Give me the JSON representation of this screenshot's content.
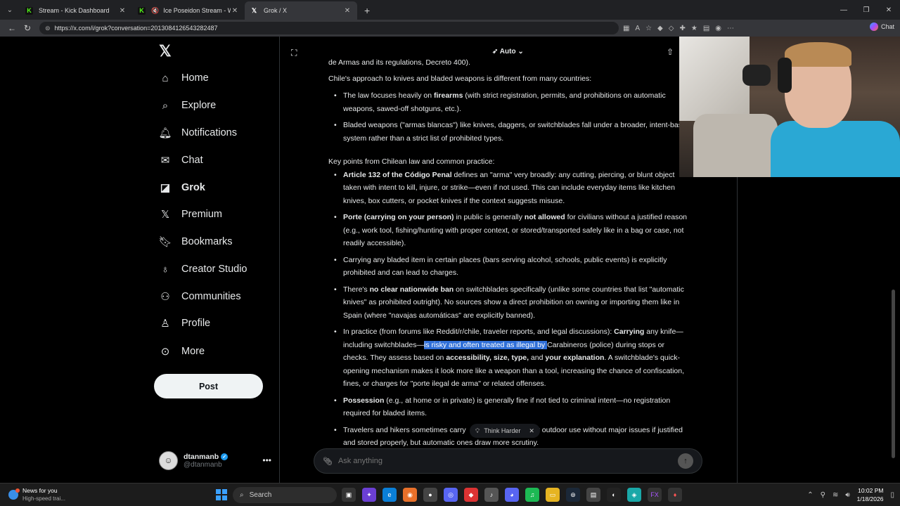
{
  "browser": {
    "tabs": [
      {
        "label": "Stream - Kick Dashboard",
        "favicon": "kick-icon"
      },
      {
        "label": "Ice Poseidon Stream - Watch",
        "favicon": "kick-icon"
      },
      {
        "label": "Grok / X",
        "favicon": "x-icon"
      }
    ],
    "url": "https://x.com/i/grok?conversation=2013084126543282487",
    "chat_label": "Chat"
  },
  "sidebar": {
    "items": [
      {
        "label": "Home",
        "icon": "home-icon"
      },
      {
        "label": "Explore",
        "icon": "search-icon"
      },
      {
        "label": "Notifications",
        "icon": "bell-icon"
      },
      {
        "label": "Chat",
        "icon": "mail-icon"
      },
      {
        "label": "Grok",
        "icon": "grok-icon"
      },
      {
        "label": "Premium",
        "icon": "x-icon"
      },
      {
        "label": "Bookmarks",
        "icon": "bookmark-icon"
      },
      {
        "label": "Creator Studio",
        "icon": "creator-icon"
      },
      {
        "label": "Communities",
        "icon": "people-icon"
      },
      {
        "label": "Profile",
        "icon": "person-icon"
      },
      {
        "label": "More",
        "icon": "more-icon"
      }
    ],
    "post_label": "Post",
    "profile": {
      "name": "dtanmanb",
      "handle": "@dtanmanb"
    }
  },
  "grok": {
    "mode": "Auto",
    "intro_fragment": "de Armas and its regulations, Decreto 400).",
    "intro": "Chile's approach to knives and bladed weapons is different from many countries:",
    "approach_points": [
      {
        "bold": "",
        "pre": "The law focuses heavily on ",
        "b": "firearms",
        "post": " (with strict registration, permits, and prohibitions on automatic weapons, sawed-off shotguns, etc.)."
      },
      {
        "bold": "",
        "pre": "Bladed weapons (\"armas blancas\") like knives, daggers, or switchblades fall under a broader, intent-based system rather than a strict list of prohibited types.",
        "b": "",
        "post": ""
      }
    ],
    "key_points_title": "Key points from Chilean law and common practice:",
    "kp1_bold": "Article 132 of the Código Penal",
    "kp1_text": " defines an \"arma\" very broadly: any cutting, piercing, or blunt object taken with intent to kill, injure, or strike—even if not used. This can include everyday items like kitchen knives, box cutters, or pocket knives if the context suggests misuse.",
    "kp2_bold": "Porte (carrying on your person)",
    "kp2_a": " in public is generally ",
    "kp2_bold2": "not allowed",
    "kp2_b": " for civilians without a justified reason (e.g., work tool, fishing/hunting with proper context, or stored/transported safely like in a bag or case, not readily accessible).",
    "kp3_text": "Carrying any bladed item in certain places (bars serving alcohol, schools, public events) is explicitly prohibited and can lead to charges.",
    "kp4_a": "There's ",
    "kp4_bold": "no clear nationwide ban",
    "kp4_b": " on switchblades specifically (unlike some countries that list \"automatic knives\" as prohibited outright). No sources show a direct prohibition on owning or importing them like in Spain (where \"navajas automáticas\" are explicitly banned).",
    "kp5_a": "In practice (from forums like Reddit/r/chile, traveler reports, and legal discussions): ",
    "kp5_bold": "Carrying",
    "kp5_b": " any knife—including switchblades—",
    "kp5_highlight": "is risky and often treated as illegal by ",
    "kp5_c": "Carabineros (police) during stops or checks. They assess based on ",
    "kp5_bold2": "accessibility, size, type,",
    "kp5_d": " and ",
    "kp5_bold3": "your explanation",
    "kp5_e": ". A switchblade's quick-opening mechanism makes it look more like a weapon than a tool, increasing the chance of confiscation, fines, or charges for \"porte ilegal de arma\" or related offenses.",
    "kp6_bold": "Possession",
    "kp6_text": " (e.g., at home or in private) is generally fine if not tied to criminal intent—no registration required for bladed items.",
    "kp7_a": "Travelers and hikers sometimes carry",
    "kp7_b": " for outdoor use without major issues if justified and stored properly, but automatic ones draw more scrutiny.",
    "think_harder": "Think Harder",
    "ask_placeholder": "Ask anything"
  },
  "taskbar": {
    "news_title": "News for you",
    "news_sub": "High-speed trai...",
    "search": "Search",
    "time": "10:02 PM",
    "date": "1/18/2026"
  }
}
